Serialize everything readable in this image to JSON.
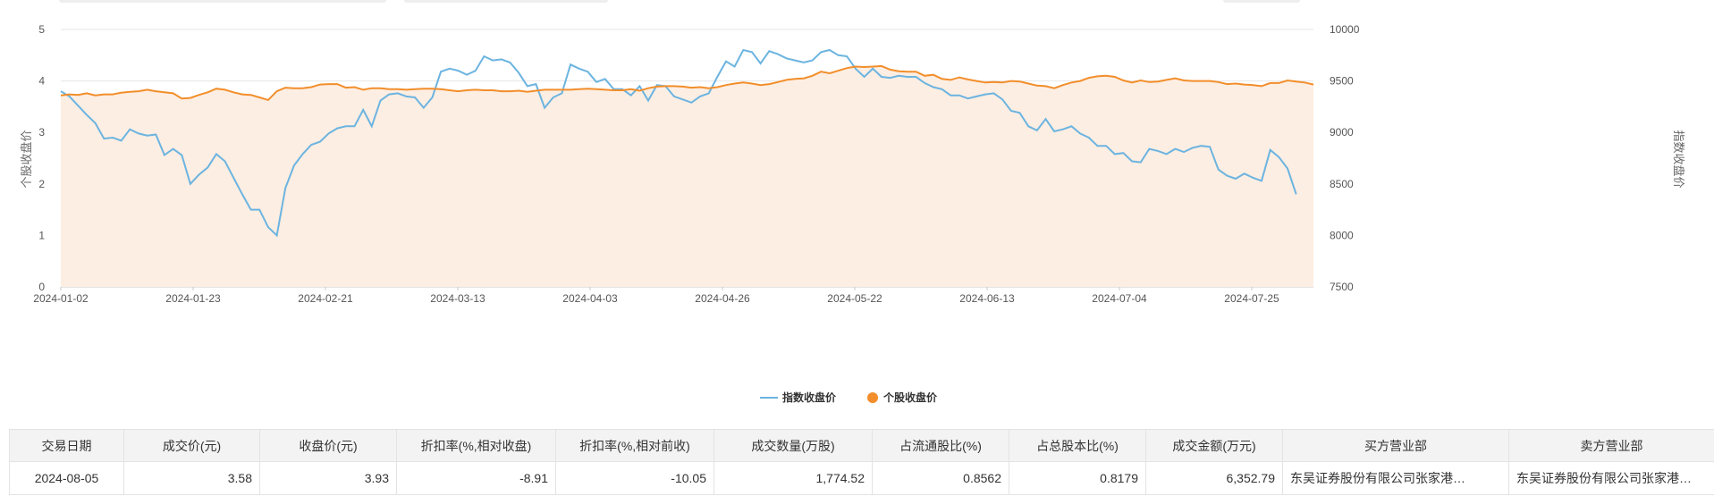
{
  "chart_data": {
    "type": "line",
    "x_dates": [
      "2024-01-02",
      "2024-01-23",
      "2024-02-21",
      "2024-03-13",
      "2024-04-03",
      "2024-04-26",
      "2024-05-22",
      "2024-06-13",
      "2024-07-04",
      "2024-07-25"
    ],
    "left_axis": {
      "name": "个股收盘价",
      "ticks": [
        "0",
        "1",
        "2",
        "3",
        "4",
        "5"
      ],
      "ylim": [
        0,
        5
      ]
    },
    "right_axis": {
      "name": "指数收盘价",
      "ticks": [
        "7500",
        "8000",
        "8500",
        "9000",
        "9500",
        "10000"
      ],
      "ylim": [
        7500,
        10000
      ]
    },
    "legend": {
      "position": "bottom-center"
    },
    "grid": true,
    "series": [
      {
        "name": "指数收盘价",
        "color": "#6cb4e0",
        "axis": "right",
        "values": [
          9400,
          9350,
          9260,
          9170,
          9090,
          8940,
          8950,
          8920,
          9030,
          8990,
          8970,
          8980,
          8780,
          8840,
          8780,
          8500,
          8590,
          8660,
          8790,
          8720,
          8560,
          8400,
          8250,
          8250,
          8080,
          8000,
          8460,
          8680,
          8790,
          8880,
          8910,
          8990,
          9040,
          9060,
          9060,
          9220,
          9060,
          9310,
          9370,
          9380,
          9350,
          9340,
          9240,
          9340,
          9590,
          9620,
          9600,
          9560,
          9600,
          9740,
          9700,
          9710,
          9680,
          9580,
          9450,
          9470,
          9240,
          9340,
          9380,
          9660,
          9620,
          9590,
          9490,
          9520,
          9420,
          9420,
          9360,
          9450,
          9310,
          9460,
          9450,
          9350,
          9320,
          9290,
          9350,
          9380,
          9540,
          9690,
          9640,
          9800,
          9780,
          9670,
          9790,
          9760,
          9720,
          9700,
          9680,
          9700,
          9780,
          9800,
          9750,
          9740,
          9620,
          9540,
          9620,
          9540,
          9530,
          9550,
          9540,
          9540,
          9480,
          9440,
          9420,
          9360,
          9360,
          9330,
          9350,
          9370,
          9380,
          9320,
          9210,
          9190,
          9060,
          9020,
          9130,
          9010,
          9030,
          9060,
          8990,
          8950,
          8870,
          8870,
          8790,
          8800,
          8720,
          8710,
          8840,
          8820,
          8790,
          8840,
          8810,
          8850,
          8870,
          8860,
          8640,
          8580,
          8550,
          8600,
          8560,
          8530,
          8830,
          8760,
          8650,
          8400
        ]
      },
      {
        "name": "个股收盘价",
        "color": "#f28e2b",
        "axis": "left",
        "values": [
          3.72,
          3.74,
          3.73,
          3.76,
          3.72,
          3.74,
          3.74,
          3.77,
          3.79,
          3.8,
          3.83,
          3.8,
          3.78,
          3.76,
          3.66,
          3.67,
          3.73,
          3.78,
          3.85,
          3.83,
          3.78,
          3.74,
          3.73,
          3.68,
          3.63,
          3.8,
          3.87,
          3.86,
          3.86,
          3.88,
          3.93,
          3.94,
          3.94,
          3.87,
          3.88,
          3.83,
          3.86,
          3.86,
          3.84,
          3.84,
          3.83,
          3.84,
          3.85,
          3.85,
          3.84,
          3.82,
          3.8,
          3.82,
          3.83,
          3.82,
          3.82,
          3.8,
          3.8,
          3.81,
          3.79,
          3.81,
          3.83,
          3.83,
          3.83,
          3.83,
          3.84,
          3.85,
          3.84,
          3.83,
          3.82,
          3.82,
          3.84,
          3.81,
          3.86,
          3.89,
          3.9,
          3.9,
          3.89,
          3.87,
          3.88,
          3.86,
          3.88,
          3.92,
          3.95,
          3.97,
          3.95,
          3.92,
          3.94,
          3.98,
          4.02,
          4.04,
          4.05,
          4.1,
          4.18,
          4.15,
          4.2,
          4.25,
          4.28,
          4.27,
          4.28,
          4.29,
          4.22,
          4.19,
          4.18,
          4.18,
          4.1,
          4.12,
          4.04,
          4.02,
          4.07,
          4.03,
          4.0,
          3.97,
          3.98,
          3.97,
          4.0,
          3.99,
          3.95,
          3.91,
          3.9,
          3.86,
          3.92,
          3.97,
          4.0,
          4.06,
          4.09,
          4.1,
          4.08,
          4.01,
          3.97,
          4.01,
          3.98,
          3.99,
          4.02,
          4.05,
          4.01,
          4.0,
          4.0,
          4.0,
          3.98,
          3.94,
          3.95,
          3.93,
          3.92,
          3.9,
          3.96,
          3.96,
          4.01,
          3.99,
          3.97,
          3.93
        ]
      }
    ]
  },
  "table": {
    "headers": [
      "交易日期",
      "成交价(元)",
      "收盘价(元)",
      "折扣率(%,相对收盘)",
      "折扣率(%,相对前收)",
      "成交数量(万股)",
      "占流通股比(%)",
      "占总股本比(%)",
      "成交金额(万元)",
      "买方营业部",
      "卖方营业部"
    ],
    "rows": [
      [
        "2024-08-05",
        "3.58",
        "3.93",
        "-8.91",
        "-10.05",
        "1,774.52",
        "0.8562",
        "0.8179",
        "6,352.79",
        "东吴证券股份有限公司张家港…",
        "东吴证券股份有限公司张家港…"
      ]
    ]
  },
  "colors": {
    "fill": "#fdeee3",
    "grid": "#e6e6e6",
    "header_bg": "#f3f3f3"
  }
}
